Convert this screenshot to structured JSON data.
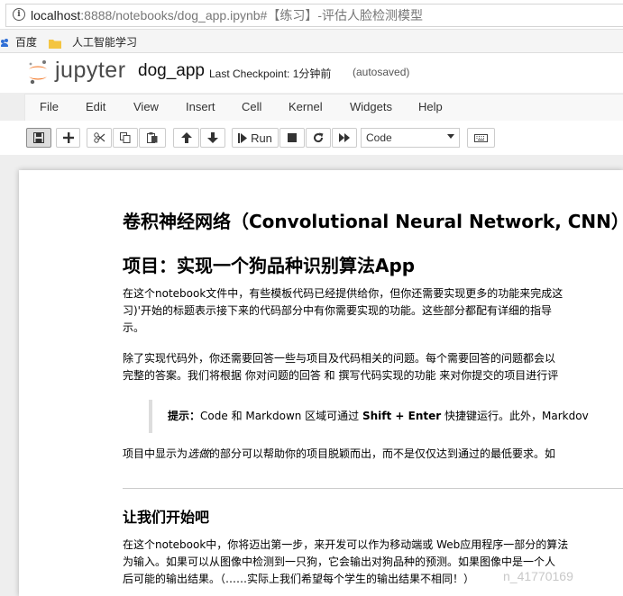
{
  "browser": {
    "url_host": "localhost",
    "url_path": ":8888/notebooks/dog_app.ipynb#【练习】-评估人脸检测模型",
    "bookmarks": [
      {
        "label": "百度",
        "icon": "paw-icon"
      },
      {
        "label": "人工智能学习",
        "icon": "folder-icon"
      }
    ]
  },
  "header": {
    "logo_text": "jupyter",
    "notebook_name": "dog_app",
    "checkpoint_label": "Last Checkpoint: 1分钟前",
    "autosave_status": "(autosaved)"
  },
  "menu": [
    "File",
    "Edit",
    "View",
    "Insert",
    "Cell",
    "Kernel",
    "Widgets",
    "Help"
  ],
  "toolbar": {
    "run_label": "Run",
    "cell_type": "Code",
    "icons": [
      "save-icon",
      "plus-icon",
      "cut-icon",
      "copy-icon",
      "paste-icon",
      "arrow-up-icon",
      "arrow-down-icon",
      "step-forward-icon",
      "stop-icon",
      "restart-icon",
      "fast-forward-icon",
      "keyboard-icon"
    ]
  },
  "content": {
    "h1": "卷积神经网络（Convolutional Neural Network, CNN）",
    "h2_project": "项目：实现一个狗品种识别算法App",
    "para1_line1": "在这个notebook文件中，有些模板代码已经提供给你，但你还需要实现更多的功能来完成这",
    "para1_line2": "习)'开始的标题表示接下来的代码部分中有你需要实现的功能。这些部分都配有详细的指导",
    "para1_line3": "示。",
    "para2_line1": "除了实现代码外，你还需要回答一些与项目及代码相关的问题。每个需要回答的问题都会以",
    "para2_line2": "完整的答案。我们将根据 你对问题的回答 和 撰写代码实现的功能 来对你提交的项目进行评",
    "tip_label": "提示：",
    "tip_code": "Code",
    "tip_and": " 和 ",
    "tip_markdown": "Markdown",
    "tip_region": " 区域可通过 ",
    "tip_keys": "Shift + Enter",
    "tip_rest": " 快捷键运行。此外，Markdov",
    "para3_prefix": "项目中显示为",
    "para3_em": "选做",
    "para3_rest": "的部分可以帮助你的项目脱颖而出，而不是仅仅达到通过的最低要求。如",
    "h2_start": "让我们开始吧",
    "para4_line1": "在这个notebook中，你将迈出第一步，来开发可以作为移动端或 Web应用程序一部分的算法",
    "para4_line2": "为输入。如果可以从图像中检测到一只狗，它会输出对狗品种的预测。如果图像中是一个人",
    "para4_line3": "后可能的输出结果。（……实际上我们希望每个学生的输出结果不相同！）",
    "watermark": "n_41770169"
  }
}
